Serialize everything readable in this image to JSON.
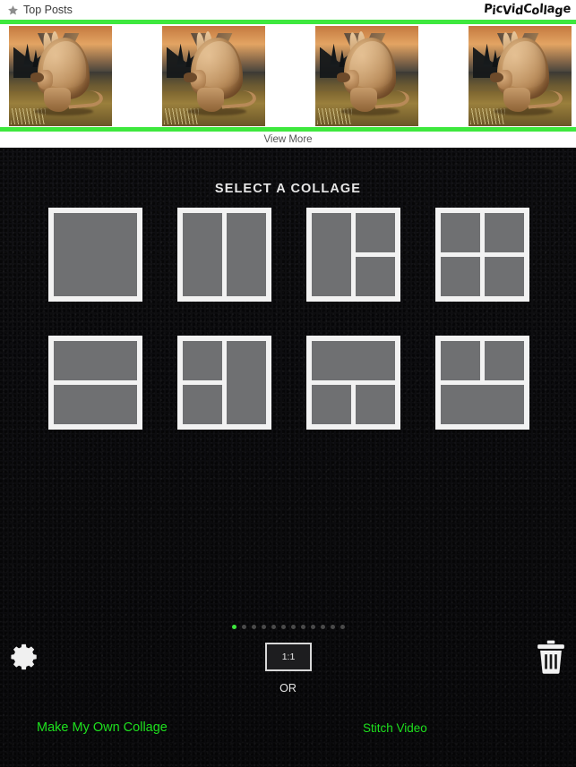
{
  "topbar": {
    "star_icon": "star-icon",
    "title": "Top Posts",
    "brand": "PicVidCollage"
  },
  "featured": {
    "view_more_label": "View More",
    "thumbnail_count": 4,
    "thumbnail_alt": "kangaroo illustration"
  },
  "main": {
    "section_title": "SELECT A COLLAGE",
    "layouts": [
      {
        "id": "layout-1",
        "name": "single",
        "cells": 1,
        "class": "lay-1"
      },
      {
        "id": "layout-2",
        "name": "two-columns",
        "cells": 2,
        "class": "lay-2"
      },
      {
        "id": "layout-3",
        "name": "left-tall-two-right",
        "cells": 3,
        "class": "lay-3"
      },
      {
        "id": "layout-4",
        "name": "two-by-two-grid",
        "cells": 4,
        "class": "lay-4"
      },
      {
        "id": "layout-5",
        "name": "two-rows",
        "cells": 2,
        "class": "lay-5"
      },
      {
        "id": "layout-6",
        "name": "two-left-right-tall",
        "cells": 3,
        "class": "lay-6"
      },
      {
        "id": "layout-7",
        "name": "wide-top-two-bottom",
        "cells": 3,
        "class": "lay-7"
      },
      {
        "id": "layout-8",
        "name": "two-top-wide-bottom",
        "cells": 3,
        "class": "lay-8"
      }
    ]
  },
  "pager": {
    "total": 12,
    "active_index": 0
  },
  "toolbar": {
    "settings_icon": "gear-icon",
    "trash_icon": "trash-icon",
    "aspect_ratio": "1:1",
    "or_label": "OR",
    "make_own_label": "Make My Own Collage",
    "stitch_video_label": "Stitch Video"
  },
  "colors": {
    "accent_green": "#3ee83e",
    "link_green": "#1ee01e",
    "background": "#0c0c0e",
    "card": "#f2f2f2",
    "cell": "#6f7072"
  }
}
